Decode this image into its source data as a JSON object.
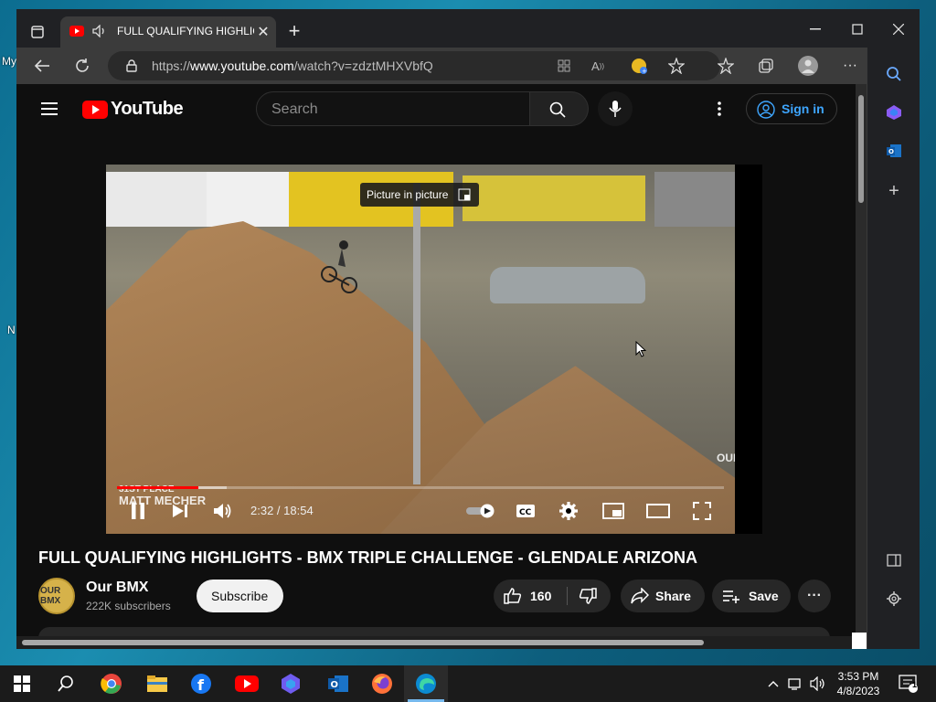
{
  "desktop": {
    "labels": [
      "My",
      "N"
    ]
  },
  "browser": {
    "tab": {
      "title": "FULL QUALIFYING HIGHLIGHTS - BMX TRIPLE CHALLENGE - GLENDALE ARIZONA",
      "icons": [
        "youtube-favicon",
        "speaker-icon",
        "close-icon"
      ]
    },
    "new_tab_icon": "plus-icon",
    "window_controls": [
      "minimize-icon",
      "maximize-icon",
      "close-icon"
    ],
    "address_bar": {
      "url_prefix": "https://",
      "url_domain": "www.youtube.com",
      "url_path": "/watch?v=zdztMHXVbfQ"
    }
  },
  "youtube": {
    "logo_text": "YouTube",
    "search": {
      "placeholder": "Search"
    },
    "sign_in": "Sign in",
    "player": {
      "tooltip": "Picture in picture",
      "time": "2:32 / 18:54",
      "progress_fraction": 0.134,
      "lower_third_line1": "31ST PLACE",
      "lower_third_line2": "MATT MECHER",
      "watermark": "OURBMX"
    },
    "video_title": "FULL QUALIFYING HIGHLIGHTS - BMX TRIPLE CHALLENGE - GLENDALE ARIZONA",
    "channel": {
      "avatar_text": "OUR BMX",
      "name": "Our BMX",
      "subscribers": "222K subscribers"
    },
    "subscribe": "Subscribe",
    "likes": "160",
    "share": "Share",
    "save": "Save"
  },
  "taskbar": {
    "time": "3:53 PM",
    "date": "4/8/2023",
    "notification_count": "1"
  }
}
